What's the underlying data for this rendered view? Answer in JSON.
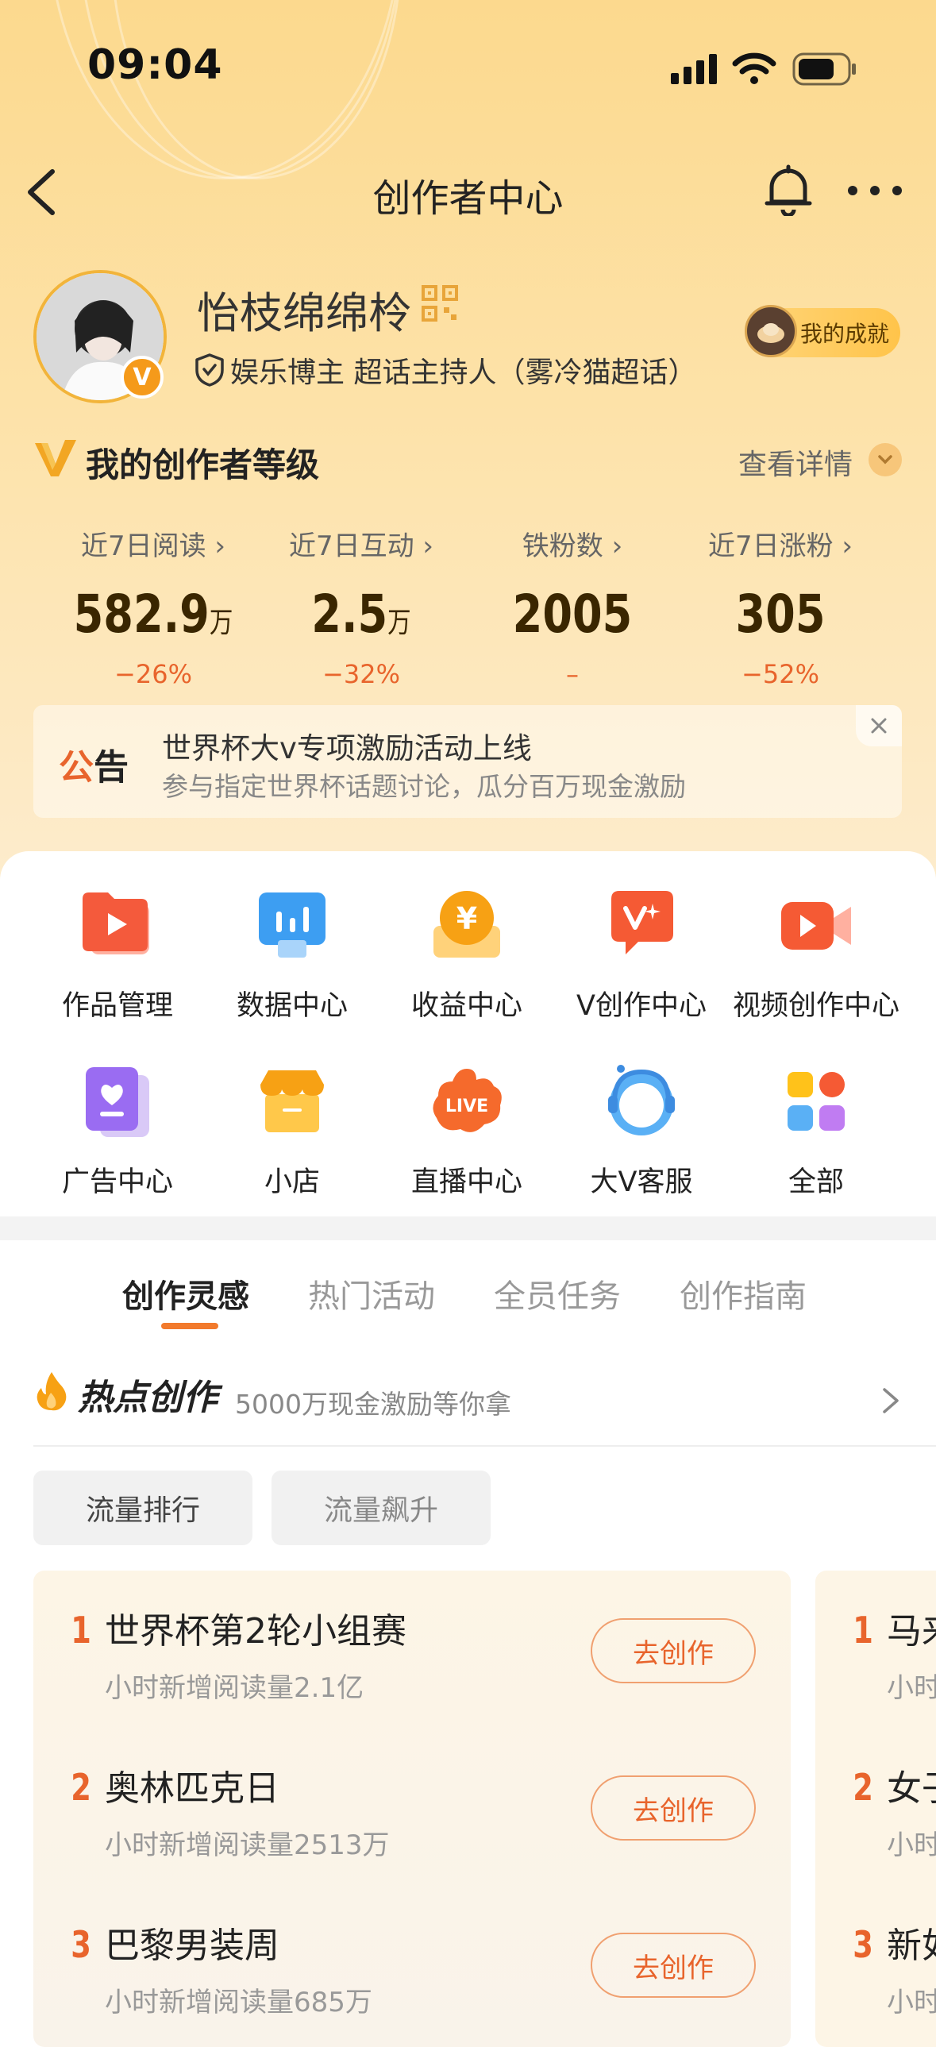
{
  "status": {
    "time": "09:04"
  },
  "header": {
    "title": "创作者中心"
  },
  "profile": {
    "name": "怡枝绵绵柃",
    "tags": "娱乐博主 超话主持人（雾冷猫超话）",
    "achievement_label": "我的成就",
    "badge": "V"
  },
  "level": {
    "title": "我的创作者等级",
    "detail_label": "查看详情"
  },
  "stats": [
    {
      "label": "近7日阅读",
      "value": "582.9",
      "unit": "万",
      "change": "−26%"
    },
    {
      "label": "近7日互动",
      "value": "2.5",
      "unit": "万",
      "change": "−32%"
    },
    {
      "label": "铁粉数",
      "value": "2005",
      "unit": "",
      "change": "–"
    },
    {
      "label": "近7日涨粉",
      "value": "305",
      "unit": "",
      "change": "−52%"
    }
  ],
  "notice": {
    "tag": "公告",
    "title": "世界杯大v专项激励活动上线",
    "subtitle": "参与指定世界杯话题讨论，瓜分百万现金激励"
  },
  "tools": [
    {
      "label": "作品管理",
      "icon": "play-folder-icon"
    },
    {
      "label": "数据中心",
      "icon": "bar-chart-icon"
    },
    {
      "label": "收益中心",
      "icon": "yuan-coin-icon"
    },
    {
      "label": "V创作中心",
      "icon": "sparkle-v-icon"
    },
    {
      "label": "视频创作中心",
      "icon": "video-camera-icon"
    },
    {
      "label": "广告中心",
      "icon": "ad-heart-icon"
    },
    {
      "label": "小店",
      "icon": "shop-icon"
    },
    {
      "label": "直播中心",
      "icon": "live-icon"
    },
    {
      "label": "大V客服",
      "icon": "headset-icon"
    },
    {
      "label": "全部",
      "icon": "grid-apps-icon"
    }
  ],
  "tabs": [
    "创作灵感",
    "热门活动",
    "全员任务",
    "创作指南"
  ],
  "hot": {
    "title": "热点创作",
    "subtitle": "5000万现金激励等你拿"
  },
  "filters": [
    "流量排行",
    "流量飙升"
  ],
  "ranking": [
    {
      "rank": "1",
      "title": "世界杯第2轮小组赛",
      "sub": "小时新增阅读量2.1亿",
      "action": "去创作"
    },
    {
      "rank": "2",
      "title": "奥林匹克日",
      "sub": "小时新增阅读量2513万",
      "action": "去创作"
    },
    {
      "rank": "3",
      "title": "巴黎男装周",
      "sub": "小时新增阅读量685万",
      "action": "去创作"
    }
  ],
  "ranking2": [
    {
      "rank": "1",
      "title": "马来",
      "sub": "小时"
    },
    {
      "rank": "2",
      "title": "女子",
      "sub": "小时"
    },
    {
      "rank": "3",
      "title": "新如",
      "sub": "小时"
    }
  ],
  "colors": {
    "accent": "#e8642c",
    "header_bg": "#fcd98e",
    "badge": "#f59a1a"
  }
}
